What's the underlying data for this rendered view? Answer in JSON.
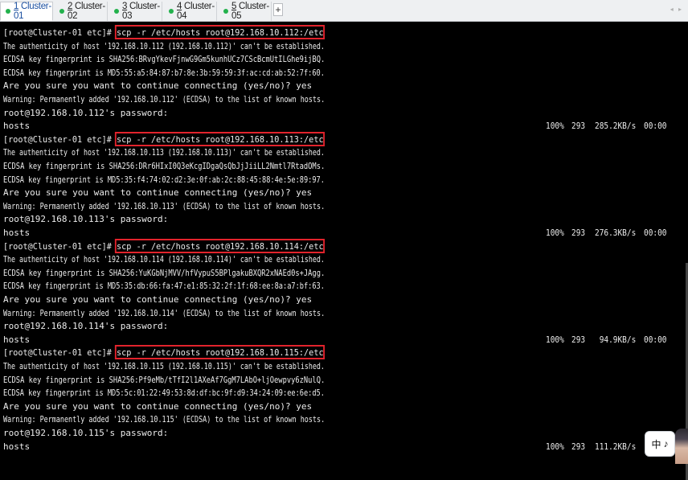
{
  "tabs": [
    {
      "num": "1",
      "label": " Cluster-01",
      "active": true
    },
    {
      "num": "2",
      "label": " Cluster-02",
      "active": false
    },
    {
      "num": "3",
      "label": " Cluster-03",
      "active": false
    },
    {
      "num": "4",
      "label": " Cluster-04",
      "active": false
    },
    {
      "num": "5",
      "label": " Cluster-05",
      "active": false
    }
  ],
  "add_tab_label": "+",
  "prompt": "[root@Cluster-01 etc]# ",
  "lines": [
    "The authenticity of host '192.168.10.112 (192.168.10.112)' can't be established.",
    "ECDSA key fingerprint is SHA256:BRvgYkevFjnwG9Gm5kunhUCz7CScBcmUtILGhe9ijBQ.",
    "ECDSA key fingerprint is MD5:55:a5:84:87:b7:8e:3b:59:59:3f:ac:cd:ab:52:7f:60.",
    "Are you sure you want to continue connecting (yes/no)? yes",
    "Warning: Permanently added '192.168.10.112' (ECDSA) to the list of known hosts.",
    "root@192.168.10.112's password:",
    "hosts",
    "The authenticity of host '192.168.10.113 (192.168.10.113)' can't be established.",
    "ECDSA key fingerprint is SHA256:DRr6HIxI0Q3eKcgIDgaQsQbJjJiiLL2Nmtl7RtadOMs.",
    "ECDSA key fingerprint is MD5:35:f4:74:02:d2:3e:0f:ab:2c:88:45:88:4e:5e:89:97.",
    "Are you sure you want to continue connecting (yes/no)? yes",
    "Warning: Permanently added '192.168.10.113' (ECDSA) to the list of known hosts.",
    "root@192.168.10.113's password:",
    "hosts",
    "The authenticity of host '192.168.10.114 (192.168.10.114)' can't be established.",
    "ECDSA key fingerprint is SHA256:YuKGbNjMVV/hfVypuS5BPlgakuBXQR2xNAEd0s+JAgg.",
    "ECDSA key fingerprint is MD5:35:db:66:fa:47:e1:85:32:2f:1f:68:ee:8a:a7:bf:63.",
    "Are you sure you want to continue connecting (yes/no)? yes",
    "Warning: Permanently added '192.168.10.114' (ECDSA) to the list of known hosts.",
    "root@192.168.10.114's password:",
    "hosts",
    "The authenticity of host '192.168.10.115 (192.168.10.115)' can't be established.",
    "ECDSA key fingerprint is SHA256:Pf9eMb/tTfI2l1AXeAf7GgM7LAbO+ljOewpvy6zNulQ.",
    "ECDSA key fingerprint is MD5:5c:01:22:49:53:8d:df:bc:9f:d9:34:24:09:ee:6e:d5.",
    "Are you sure you want to continue connecting (yes/no)? yes",
    "Warning: Permanently added '192.168.10.115' (ECDSA) to the list of known hosts.",
    "root@192.168.10.115's password:",
    "hosts"
  ],
  "commands": [
    "scp -r /etc/hosts root@192.168.10.112:/etc",
    "scp -r /etc/hosts root@192.168.10.113:/etc",
    "scp -r /etc/hosts root@192.168.10.114:/etc",
    "scp -r /etc/hosts root@192.168.10.115:/etc"
  ],
  "transfers": [
    {
      "percent": "100%",
      "size": "293",
      "speed": "285.2KB/s",
      "time": "00:00"
    },
    {
      "percent": "100%",
      "size": "293",
      "speed": "276.3KB/s",
      "time": "00:00"
    },
    {
      "percent": "100%",
      "size": "293",
      "speed": " 94.9KB/s",
      "time": "00:00"
    },
    {
      "percent": "100%",
      "size": "293",
      "speed": "111.2KB/s",
      "time": ""
    }
  ],
  "widget": {
    "icon_left": "中",
    "icon_right": "♪"
  },
  "colors": {
    "highlight": "#e2232c",
    "tab_dot": "#22b14c",
    "terminal_bg": "#000000",
    "terminal_fg": "#ececec"
  }
}
